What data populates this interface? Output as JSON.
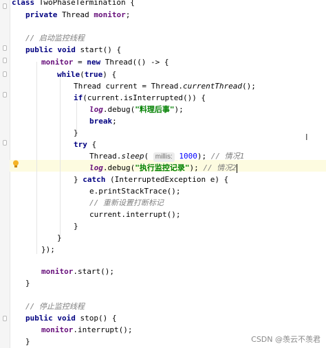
{
  "code": {
    "line1": "class TwoPhaseTermination {",
    "line2_kw": "private",
    "line2_rest": " Thread ",
    "line2_field": "monitor",
    "line2_end": ";",
    "comment_start": "// 启动监控线程",
    "start_sig_kw": "public void",
    "start_sig_rest": " start() {",
    "monitor_assign_field": "monitor",
    "monitor_assign_mid": " = ",
    "monitor_assign_kw": "new",
    "monitor_assign_rest": " Thread(() -> {",
    "while_kw": "while",
    "while_paren_open": "(",
    "while_true": "true",
    "while_end": ") {",
    "current_decl_a": "Thread current = Thread.",
    "current_decl_it": "currentThread",
    "current_decl_b": "();",
    "if_kw": "if",
    "if_rest": "(current.isInterrupted()) {",
    "log_it": "log",
    "log_debug": ".debug(",
    "log1_str": "\"料理后事\"",
    "log_end": ");",
    "break_kw": "break",
    "semicolon": ";",
    "close_brace": "}",
    "try_kw": "try",
    "try_rest": " {",
    "sleep_a": "Thread.",
    "sleep_it": "sleep",
    "sleep_paren": "( ",
    "sleep_hint": "millis:",
    "sleep_num": " 1000",
    "sleep_end": "); ",
    "sleep_comment": "// 情况1",
    "log2_str": "\"执行监控记录\"",
    "log2_end": "); ",
    "log2_comment": "// 情况2",
    "catch_a": "} ",
    "catch_kw": "catch",
    "catch_rest": " (InterruptedException e) {",
    "print_trace": "e.printStackTrace();",
    "reset_comment": "// 重新设置打断标记",
    "interrupt_self": "current.interrupt();",
    "thread_close": "});",
    "monitor_start_field": "monitor",
    "monitor_start_rest": ".start();",
    "comment_stop": "// 停止监控线程",
    "stop_sig_rest": " stop() {",
    "monitor_interrupt_rest": ".interrupt();"
  },
  "watermark": "CSDN @羡云不羡君",
  "icons": [
    "lightbulb-icon",
    "text-cursor-icon",
    "fold-marker-icon"
  ]
}
